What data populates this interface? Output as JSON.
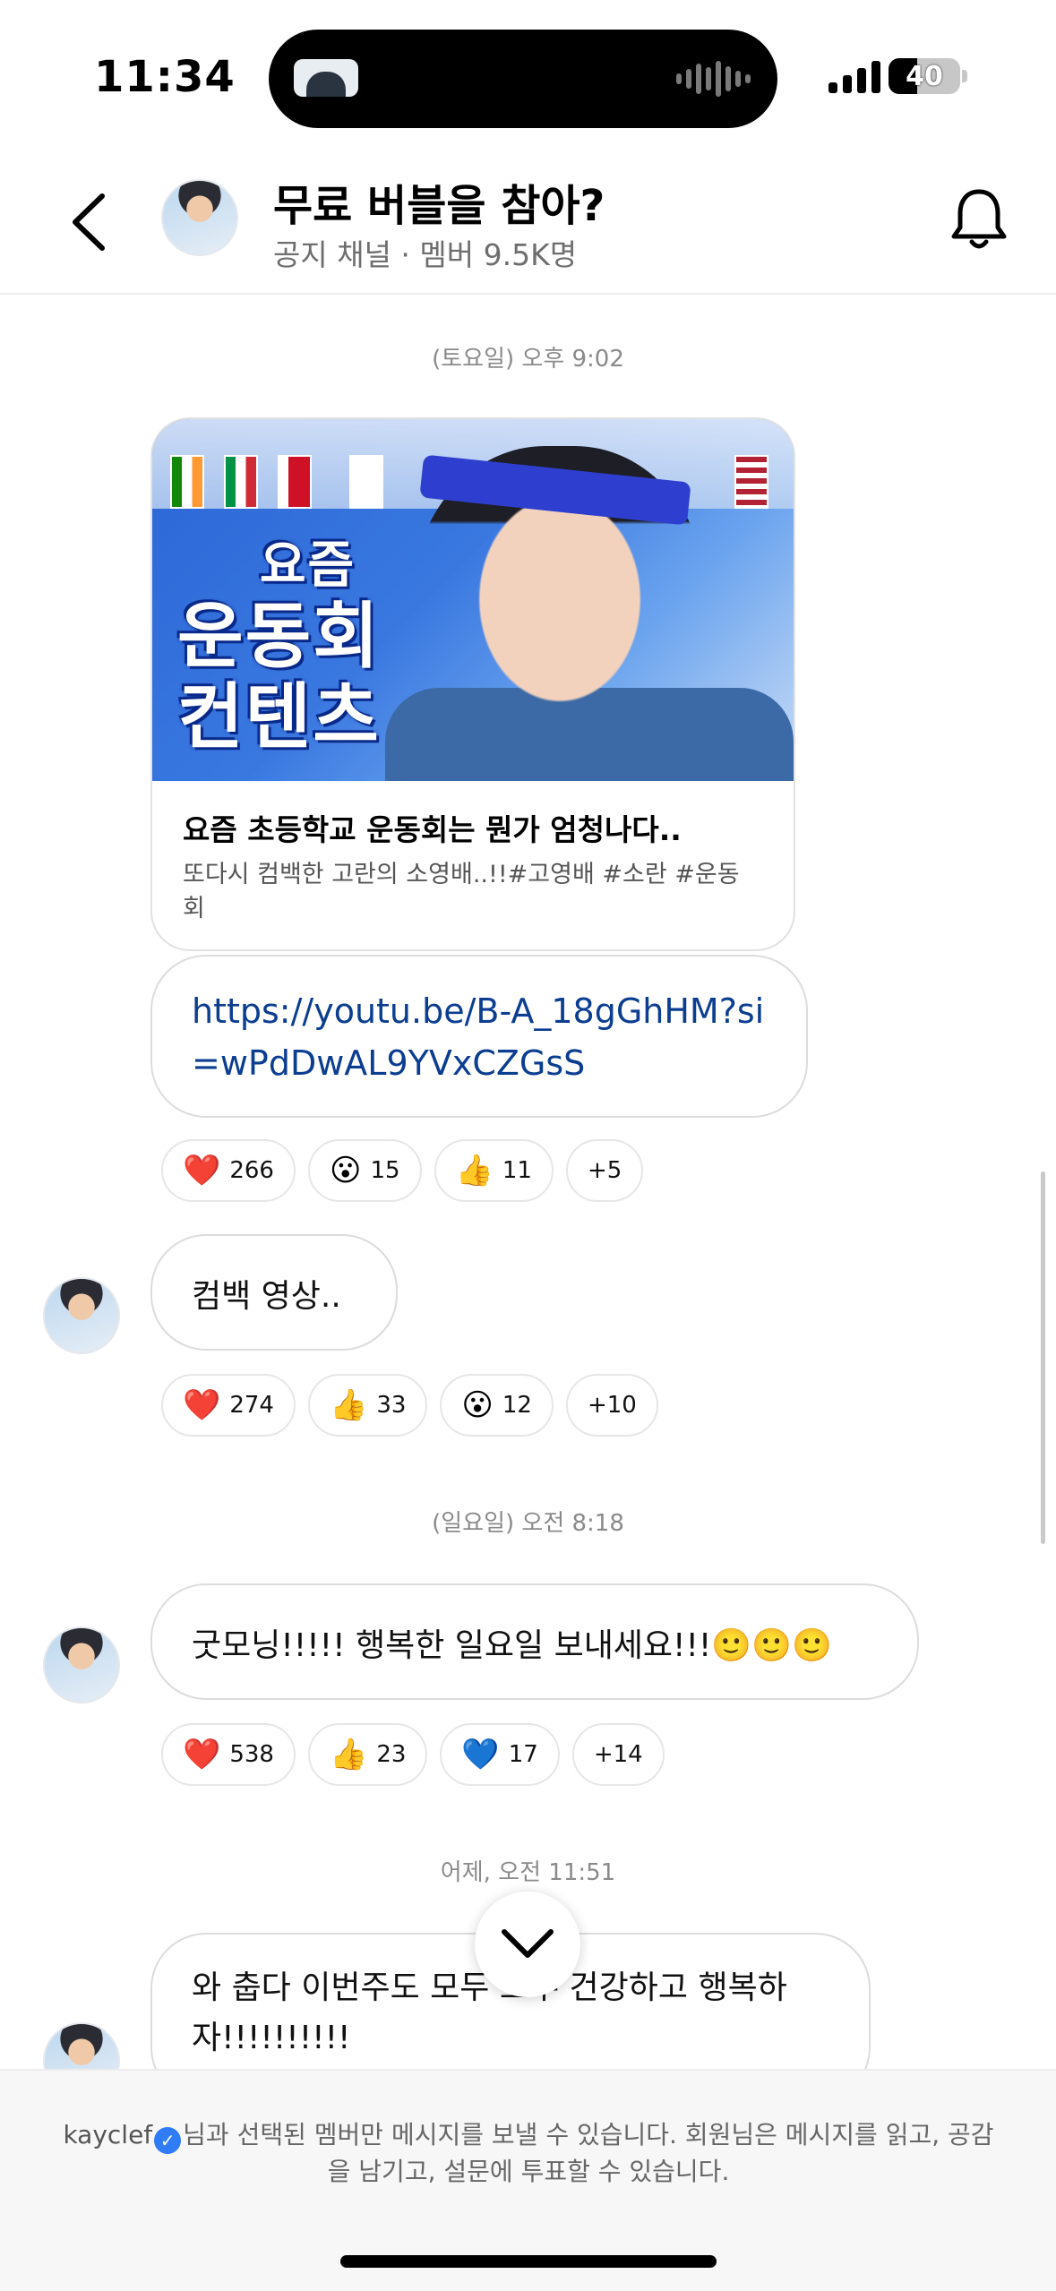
{
  "status_bar": {
    "time": "11:34",
    "battery": "40",
    "battery_level": 0.4
  },
  "header": {
    "title": "무료 버블을 참아?",
    "subtitle": "공지 채널 · 멤버 9.5K명"
  },
  "messages": [
    {
      "timestamp": "(토요일) 오후 9:02",
      "card": {
        "thumb_text": [
          "요즘",
          "운동회",
          "컨텐츠"
        ],
        "title": "요즘 초등학교 운동회는 뭔가 엄청나다..",
        "description": "또다시 컴백한 고란의 소영배..!!#고영배 #소란 #운동회"
      },
      "link": "https://youtu.be/B-A_18gGhHM?si=wPdDwAL9YVxCZGsS",
      "reactions": [
        {
          "emoji": "❤️",
          "count": "266"
        },
        {
          "emoji": "😮",
          "count": "15"
        },
        {
          "emoji": "👍",
          "count": "11"
        },
        {
          "emoji": "",
          "count": "+5"
        }
      ]
    },
    {
      "text": "컴백 영상..",
      "reactions": [
        {
          "emoji": "❤️",
          "count": "274"
        },
        {
          "emoji": "👍",
          "count": "33"
        },
        {
          "emoji": "😮",
          "count": "12"
        },
        {
          "emoji": "",
          "count": "+10"
        }
      ]
    },
    {
      "timestamp": "(일요일) 오전 8:18",
      "text": "굿모닝!!!!! 행복한 일요일 보내세요!!!🙂🙂🙂",
      "reactions": [
        {
          "emoji": "❤️",
          "count": "538"
        },
        {
          "emoji": "👍",
          "count": "23"
        },
        {
          "emoji": "💙",
          "count": "17"
        },
        {
          "emoji": "",
          "count": "+14"
        }
      ]
    },
    {
      "timestamp": "어제, 오전 11:51",
      "text": "와 춥다 이번주도 모두 모두 건강하고 행복하자!!!!!!!!!!"
    }
  ],
  "footer": {
    "name": "kayclef",
    "notice": "님과 선택된 멤버만 메시지를 보낼 수 있습니다. 회원님은 메시지를 읽고, 공감을 남기고, 설문에 투표할 수 있습니다."
  }
}
